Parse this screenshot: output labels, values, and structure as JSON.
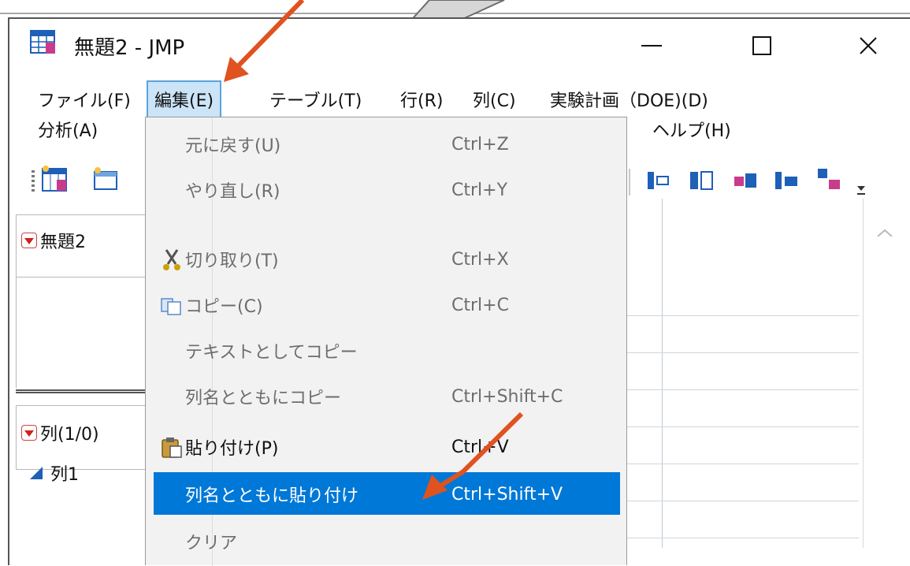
{
  "window": {
    "title": "無題2 - JMP",
    "controls": {
      "minimize": "—",
      "maximize": "☐",
      "close": "✕"
    }
  },
  "menubar": {
    "items": [
      {
        "label": "ファイル(F)"
      },
      {
        "label": "編集(E)",
        "active": true
      },
      {
        "label": "テーブル(T)"
      },
      {
        "label": "行(R)"
      },
      {
        "label": "列(C)"
      },
      {
        "label": "実験計画（DOE)(D)"
      },
      {
        "label": "分析(A)"
      },
      {
        "label": "ヘルプ(H)"
      }
    ]
  },
  "left_panels": {
    "table_panel": {
      "title": "無題2"
    },
    "columns_panel": {
      "title": "列(1/0)",
      "columns": [
        {
          "name": "列1"
        }
      ]
    }
  },
  "edit_menu": {
    "items": [
      {
        "label": "元に戻す(U)",
        "shortcut": "Ctrl+Z",
        "enabled": false
      },
      {
        "label": "やり直し(R)",
        "shortcut": "Ctrl+Y",
        "enabled": false
      },
      {
        "label": "切り取り(T)",
        "shortcut": "Ctrl+X",
        "enabled": false,
        "icon": "scissors-icon"
      },
      {
        "label": "コピー(C)",
        "shortcut": "Ctrl+C",
        "enabled": false,
        "icon": "copy-icon"
      },
      {
        "label": "テキストとしてコピー",
        "shortcut": "",
        "enabled": false
      },
      {
        "label": "列名とともにコピー",
        "shortcut": "Ctrl+Shift+C",
        "enabled": false
      },
      {
        "label": "貼り付け(P)",
        "shortcut": "Ctrl+V",
        "enabled": true,
        "icon": "paste-icon"
      },
      {
        "label": "列名とともに貼り付け",
        "shortcut": "Ctrl+Shift+V",
        "enabled": true,
        "highlighted": true
      },
      {
        "label": "クリア",
        "shortcut": "",
        "enabled": false
      }
    ]
  },
  "colors": {
    "highlight": "#0078d7",
    "active_menu_bg": "#cce4f7",
    "annotation_arrow": "#e0521f",
    "disabled_text": "#6d6d6d"
  }
}
